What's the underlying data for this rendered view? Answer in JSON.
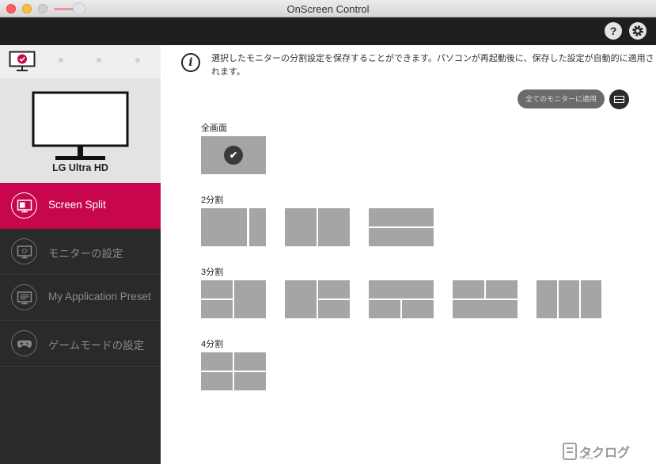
{
  "window": {
    "title": "OnScreen Control"
  },
  "toolbar": {
    "help_label": "?",
    "settings_icon": "gear-icon"
  },
  "sidebar": {
    "monitor_name": "LG Ultra HD",
    "items": [
      {
        "label": "Screen Split",
        "icon": "screen-split-icon",
        "active": true
      },
      {
        "label": "モニターの設定",
        "icon": "monitor-settings-icon",
        "active": false
      },
      {
        "label": "My Application Preset",
        "icon": "app-preset-icon",
        "active": false
      },
      {
        "label": "ゲームモードの設定",
        "icon": "gamepad-icon",
        "active": false
      }
    ]
  },
  "main": {
    "info_text": "選択したモニターの分割設定を保存することができます。パソコンが再起動後に、保存した設定が自動的に適用されます。",
    "apply_all_label": "全てのモニターに適用",
    "sections": [
      {
        "label": "全画面",
        "layouts": [
          "fullscreen"
        ]
      },
      {
        "label": "2分割",
        "layouts": [
          "2-vertical-large-left",
          "2-vertical-even",
          "2-horizontal"
        ]
      },
      {
        "label": "3分割",
        "layouts": [
          "3-left-stack-right-big",
          "3-left-big-right-stack",
          "3-top-big-bottom-pair",
          "3-top-pair-bottom-big",
          "3-columns"
        ]
      },
      {
        "label": "4分割",
        "layouts": [
          "4-grid"
        ]
      }
    ],
    "selected_layout": "fullscreen"
  },
  "watermark": {
    "text": "タクログ",
    "subtext": "Takulog"
  },
  "colors": {
    "accent": "#c8064e",
    "sidebar_bg": "#2a2a2a",
    "tile": "#a5a5a5"
  }
}
